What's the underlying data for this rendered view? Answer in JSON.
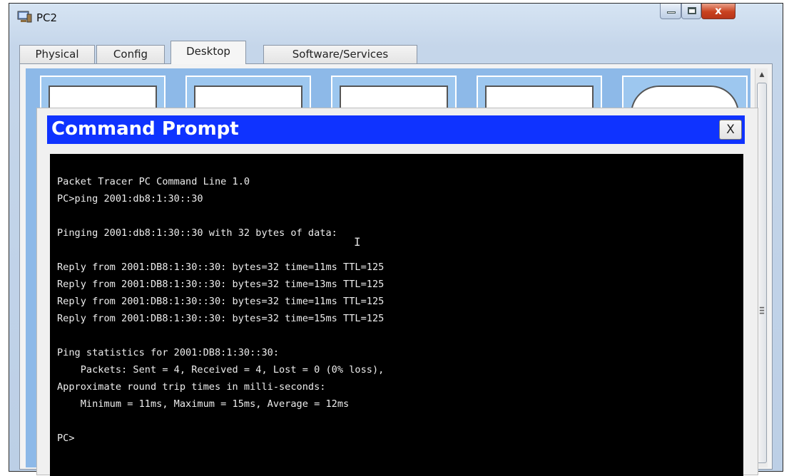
{
  "window": {
    "title": "PC2",
    "icon": "pc-computer-icon",
    "controls": {
      "minimize": "minimize-icon",
      "maximize": "maximize-icon",
      "close_label": "x"
    }
  },
  "tabs": [
    {
      "label": "Physical",
      "active": false
    },
    {
      "label": "Config",
      "active": false
    },
    {
      "label": "Desktop",
      "active": true
    },
    {
      "label": "Software/Services",
      "active": false
    }
  ],
  "desktop_apps": [
    "ip-configuration-icon",
    "dial-up-icon",
    "terminal-icon",
    "command-prompt-icon",
    "web-browser-icon"
  ],
  "command_prompt": {
    "title": "Command Prompt",
    "close_label": "X",
    "lines": [
      "Packet Tracer PC Command Line 1.0",
      "PC>ping 2001:db8:1:30::30",
      "",
      "Pinging 2001:db8:1:30::30 with 32 bytes of data:",
      "",
      "Reply from 2001:DB8:1:30::30: bytes=32 time=11ms TTL=125",
      "Reply from 2001:DB8:1:30::30: bytes=32 time=13ms TTL=125",
      "Reply from 2001:DB8:1:30::30: bytes=32 time=11ms TTL=125",
      "Reply from 2001:DB8:1:30::30: bytes=32 time=15ms TTL=125",
      "",
      "Ping statistics for 2001:DB8:1:30::30:",
      "    Packets: Sent = 4, Received = 4, Lost = 0 (0% loss),",
      "Approximate round trip times in milli-seconds:",
      "    Minimum = 11ms, Maximum = 15ms, Average = 12ms",
      "",
      "PC>"
    ]
  },
  "colors": {
    "title_bar_blue": "#0f33ff",
    "terminal_bg": "#000000",
    "terminal_text": "#ededed",
    "desktop_blue": "#8db9e8",
    "close_button_red": "#c9421f"
  }
}
